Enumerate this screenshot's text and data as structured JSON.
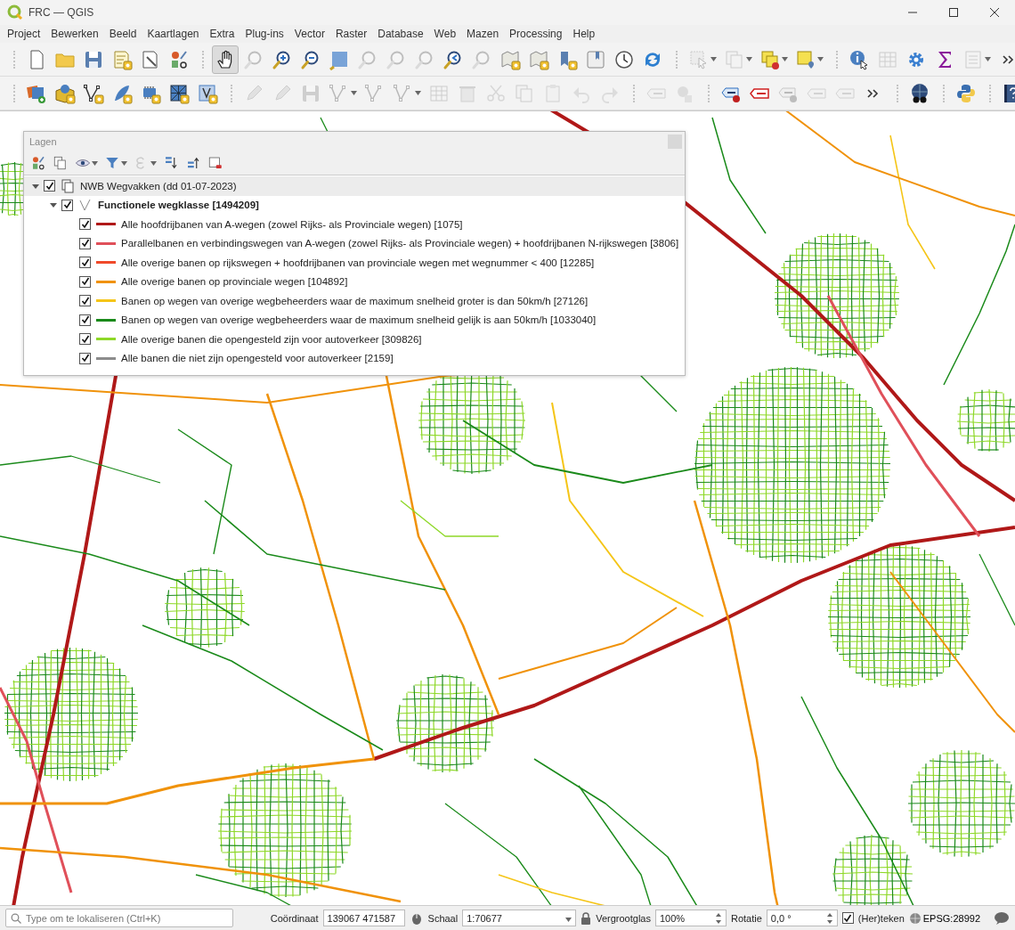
{
  "window": {
    "title": "FRC — QGIS"
  },
  "menu": [
    "Project",
    "Bewerken",
    "Beeld",
    "Kaartlagen",
    "Extra",
    "Plug-ins",
    "Vector",
    "Raster",
    "Database",
    "Web",
    "Mazen",
    "Processing",
    "Help"
  ],
  "toolbars": [
    {
      "groups": [
        {
          "tools": [
            {
              "kind": "new",
              "disabled": false,
              "selected": false,
              "dropdown": false
            },
            {
              "kind": "open",
              "disabled": false,
              "selected": false,
              "dropdown": false
            },
            {
              "kind": "save",
              "disabled": false,
              "selected": false,
              "dropdown": false
            },
            {
              "kind": "layout",
              "disabled": false,
              "selected": false,
              "dropdown": false
            },
            {
              "kind": "style-manager",
              "disabled": false,
              "selected": false,
              "dropdown": false
            },
            {
              "kind": "style",
              "disabled": false,
              "selected": false,
              "dropdown": false
            }
          ]
        },
        {
          "tools": [
            {
              "kind": "pan",
              "disabled": false,
              "selected": true,
              "dropdown": false
            },
            {
              "kind": "pan-selection",
              "disabled": true,
              "selected": false,
              "dropdown": false
            },
            {
              "kind": "zoom-in",
              "disabled": false,
              "selected": false,
              "dropdown": false
            },
            {
              "kind": "zoom-out",
              "disabled": false,
              "selected": false,
              "dropdown": false
            },
            {
              "kind": "zoom-full",
              "disabled": false,
              "selected": false,
              "dropdown": false
            },
            {
              "kind": "zoom",
              "disabled": true,
              "selected": false,
              "dropdown": false
            },
            {
              "kind": "zoom",
              "disabled": true,
              "selected": false,
              "dropdown": false
            },
            {
              "kind": "zoom-native",
              "disabled": true,
              "selected": false,
              "dropdown": false
            },
            {
              "kind": "zoom-last",
              "disabled": false,
              "selected": false,
              "dropdown": false
            },
            {
              "kind": "zoom-next",
              "disabled": true,
              "selected": false,
              "dropdown": false
            },
            {
              "kind": "map-view",
              "disabled": false,
              "selected": false,
              "dropdown": false
            },
            {
              "kind": "map-3d",
              "disabled": false,
              "selected": false,
              "dropdown": false
            },
            {
              "kind": "bookmark-new",
              "disabled": false,
              "selected": false,
              "dropdown": false
            },
            {
              "kind": "bookmarks",
              "disabled": false,
              "selected": false,
              "dropdown": false
            },
            {
              "kind": "clock",
              "disabled": false,
              "selected": false,
              "dropdown": false
            },
            {
              "kind": "refresh",
              "disabled": false,
              "selected": false,
              "dropdown": false
            }
          ]
        },
        {
          "tools": [
            {
              "kind": "select",
              "disabled": true,
              "selected": false,
              "dropdown": true
            },
            {
              "kind": "select-attr",
              "disabled": true,
              "selected": false,
              "dropdown": true
            },
            {
              "kind": "deselect",
              "disabled": false,
              "selected": false,
              "dropdown": true
            },
            {
              "kind": "select-location",
              "disabled": false,
              "selected": false,
              "dropdown": true
            }
          ]
        },
        {
          "tools": [
            {
              "kind": "identify",
              "disabled": false,
              "selected": false,
              "dropdown": false
            },
            {
              "kind": "attribute-table",
              "disabled": true,
              "selected": false,
              "dropdown": false
            },
            {
              "kind": "gear",
              "disabled": false,
              "selected": false,
              "dropdown": false
            },
            {
              "kind": "sigma",
              "disabled": false,
              "selected": false,
              "dropdown": false
            },
            {
              "kind": "list",
              "disabled": true,
              "selected": false,
              "dropdown": true
            },
            {
              "kind": "more",
              "disabled": false,
              "selected": false,
              "dropdown": false
            }
          ]
        }
      ]
    },
    {
      "groups": [
        {
          "tools": [
            {
              "kind": "data-source",
              "disabled": false,
              "selected": false,
              "dropdown": false
            },
            {
              "kind": "new-database",
              "disabled": false,
              "selected": false,
              "dropdown": false
            },
            {
              "kind": "new-vector",
              "disabled": false,
              "selected": false,
              "dropdown": false
            },
            {
              "kind": "new-feather",
              "disabled": false,
              "selected": false,
              "dropdown": false
            },
            {
              "kind": "new-chip",
              "disabled": false,
              "selected": false,
              "dropdown": false
            },
            {
              "kind": "new-mesh",
              "disabled": false,
              "selected": false,
              "dropdown": false
            },
            {
              "kind": "new-virtual",
              "disabled": false,
              "selected": false,
              "dropdown": false
            }
          ]
        },
        {
          "tools": [
            {
              "kind": "pencil",
              "disabled": true,
              "selected": false,
              "dropdown": false
            },
            {
              "kind": "pencil",
              "disabled": true,
              "selected": false,
              "dropdown": false
            },
            {
              "kind": "save",
              "disabled": true,
              "selected": false,
              "dropdown": false
            },
            {
              "kind": "add-line",
              "disabled": true,
              "selected": false,
              "dropdown": true
            },
            {
              "kind": "vertex",
              "disabled": true,
              "selected": false,
              "dropdown": false
            },
            {
              "kind": "modify",
              "disabled": true,
              "selected": false,
              "dropdown": true
            },
            {
              "kind": "attribute-table",
              "disabled": true,
              "selected": false,
              "dropdown": false
            },
            {
              "kind": "delete",
              "disabled": true,
              "selected": false,
              "dropdown": false
            },
            {
              "kind": "cut",
              "disabled": true,
              "selected": false,
              "dropdown": false
            },
            {
              "kind": "copy",
              "disabled": true,
              "selected": false,
              "dropdown": false
            },
            {
              "kind": "paste",
              "disabled": true,
              "selected": false,
              "dropdown": false
            },
            {
              "kind": "undo",
              "disabled": true,
              "selected": false,
              "dropdown": false
            },
            {
              "kind": "redo",
              "disabled": true,
              "selected": false,
              "dropdown": false
            }
          ]
        },
        {
          "tools": [
            {
              "kind": "label",
              "disabled": true,
              "selected": false,
              "dropdown": false
            },
            {
              "kind": "diagram",
              "disabled": true,
              "selected": false,
              "dropdown": false
            }
          ]
        },
        {
          "tools": [
            {
              "kind": "label-pin",
              "disabled": false,
              "selected": false,
              "dropdown": false
            },
            {
              "kind": "label-show",
              "disabled": false,
              "selected": false,
              "dropdown": false
            },
            {
              "kind": "label-pin",
              "disabled": true,
              "selected": false,
              "dropdown": false
            },
            {
              "kind": "label-hide",
              "disabled": true,
              "selected": false,
              "dropdown": false
            },
            {
              "kind": "label-move",
              "disabled": true,
              "selected": false,
              "dropdown": false
            },
            {
              "kind": "more",
              "disabled": false,
              "selected": false,
              "dropdown": false
            }
          ]
        },
        {
          "tools": [
            {
              "kind": "globe",
              "disabled": false,
              "selected": false,
              "dropdown": false
            }
          ]
        },
        {
          "tools": [
            {
              "kind": "python",
              "disabled": false,
              "selected": false,
              "dropdown": false
            }
          ]
        },
        {
          "tools": [
            {
              "kind": "help",
              "disabled": false,
              "selected": false,
              "dropdown": false
            }
          ]
        }
      ]
    }
  ],
  "layers_panel": {
    "title": "Lagen",
    "tools": [
      {
        "kind": "style",
        "disabled": false,
        "dropdown": false
      },
      {
        "kind": "add-group",
        "disabled": false,
        "dropdown": false
      },
      {
        "kind": "eye",
        "disabled": false,
        "dropdown": true
      },
      {
        "kind": "filter",
        "disabled": false,
        "dropdown": true
      },
      {
        "kind": "expression",
        "disabled": true,
        "dropdown": true
      },
      {
        "kind": "expand",
        "disabled": false,
        "dropdown": false
      },
      {
        "kind": "collapse",
        "disabled": false,
        "dropdown": false
      },
      {
        "kind": "remove",
        "disabled": false,
        "dropdown": false
      }
    ],
    "tree": [
      {
        "kind": "group",
        "label": "NWB Wegvakken (dd 01-07-2023)",
        "checked": true,
        "expanded": true,
        "selected": true,
        "children": [
          {
            "kind": "layer",
            "label": "Functionele wegklasse [1494209]",
            "checked": true,
            "expanded": true,
            "selected": false,
            "children": [
              {
                "kind": "category",
                "label": "Alle hoofdrijbanen van A-wegen (zowel Rijks- als Provinciale wegen) [1075]",
                "checked": true,
                "color": "#b01818"
              },
              {
                "kind": "category",
                "label": "Parallelbanen en verbindingswegen van A-wegen (zowel Rijks- als Provinciale wegen) + hoofdrijbanen N-rijkswegen [3806]",
                "checked": true,
                "color": "#e0505a"
              },
              {
                "kind": "category",
                "label": "Alle overige banen op rijkswegen + hoofdrijbanen van provinciale wegen met wegnummer < 400 [12285]",
                "checked": true,
                "color": "#f04a2a"
              },
              {
                "kind": "category",
                "label": "Alle overige banen op provinciale wegen [104892]",
                "checked": true,
                "color": "#f0920a"
              },
              {
                "kind": "category",
                "label": "Banen op wegen van overige wegbeheerders waar de maximum snelheid groter is dan 50km/h [27126]",
                "checked": true,
                "color": "#f5c518"
              },
              {
                "kind": "category",
                "label": "Banen op wegen van overige wegbeheerders waar de maximum snelheid gelijk is aan 50km/h [1033040]",
                "checked": true,
                "color": "#1a8a1a"
              },
              {
                "kind": "category",
                "label": "Alle overige banen die opengesteld zijn voor autoverkeer [309826]",
                "checked": true,
                "color": "#8ed828"
              },
              {
                "kind": "category",
                "label": "Alle banen die niet zijn opengesteld voor autoverkeer [2159]",
                "checked": true,
                "color": "#8c8c8c"
              }
            ]
          }
        ]
      }
    ]
  },
  "status_bar": {
    "locator": {
      "placeholder": "Type om te lokaliseren (Ctrl+K)"
    },
    "coordinate": {
      "label": "Coördinaat",
      "value": "139067  471587"
    },
    "scale": {
      "label": "Schaal",
      "value": "1:70677"
    },
    "magnifier": {
      "label": "Vergrootglas",
      "value": "100%"
    },
    "rotation": {
      "label": "Rotatie",
      "value": "0,0 °"
    },
    "render": {
      "label": "(Her)teken",
      "checked": true
    },
    "crs": "EPSG:28992"
  }
}
